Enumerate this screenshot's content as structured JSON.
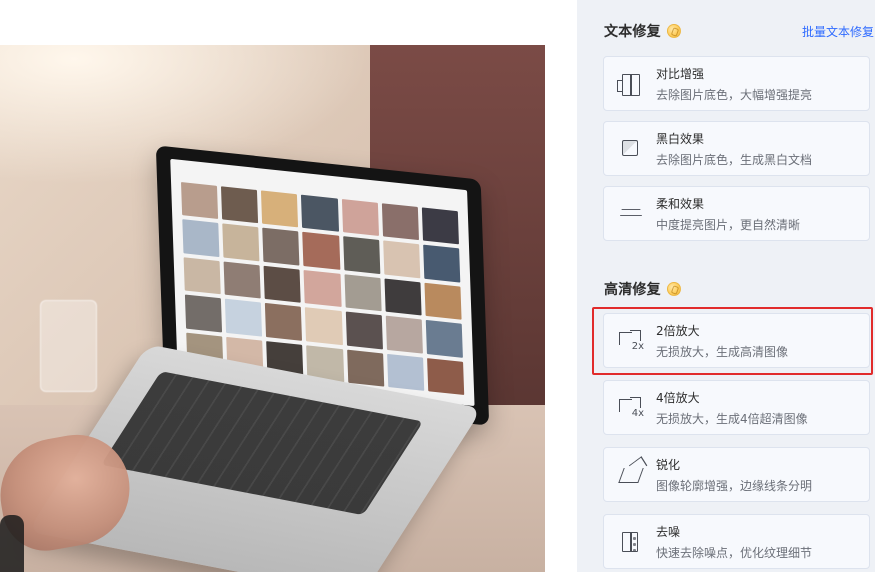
{
  "panel": {
    "text_repair": {
      "title": "文本修复",
      "batch_link": "批量文本修复",
      "items": [
        {
          "title": "对比增强",
          "desc": "去除图片底色，大幅增强提亮",
          "icon": "contrast-icon"
        },
        {
          "title": "黑白效果",
          "desc": "去除图片底色，生成黑白文档",
          "icon": "bw-effect-icon"
        },
        {
          "title": "柔和效果",
          "desc": "中度提亮图片，更自然清晰",
          "icon": "soft-effect-icon"
        }
      ]
    },
    "hd_repair": {
      "title": "高清修复",
      "items": [
        {
          "title": "2倍放大",
          "desc": "无损放大，生成高清图像",
          "icon": "upscale-2x-icon",
          "icon_label": "2x"
        },
        {
          "title": "4倍放大",
          "desc": "无损放大，生成4倍超清图像",
          "icon": "upscale-4x-icon",
          "icon_label": "4x"
        },
        {
          "title": "锐化",
          "desc": "图像轮廓增强，边缘线条分明",
          "icon": "sharpen-icon"
        },
        {
          "title": "去噪",
          "desc": "快速去除噪点，优化纹理细节",
          "icon": "denoise-icon"
        }
      ]
    }
  },
  "colors": {
    "accent_link": "#2f6bff",
    "highlight": "#e12b2b",
    "panel_bg": "#eef1f6"
  }
}
